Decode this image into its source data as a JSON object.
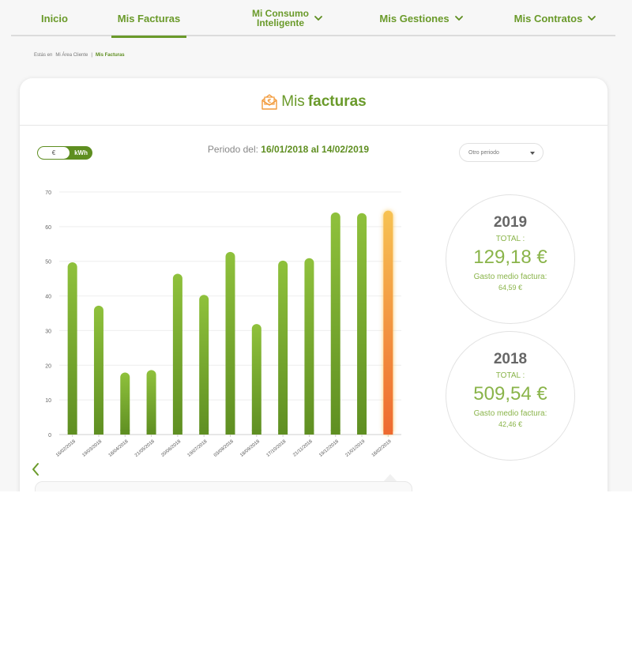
{
  "nav": {
    "items": [
      {
        "label": "Inicio",
        "dropdown": false,
        "active": false
      },
      {
        "label": "Mis Facturas",
        "dropdown": false,
        "active": true
      },
      {
        "label_line1": "Mi Consumo",
        "label_line2": "Inteligente",
        "dropdown": true,
        "active": false
      },
      {
        "label": "Mis Gestiones",
        "dropdown": true,
        "active": false
      },
      {
        "label": "Mis Contratos",
        "dropdown": true,
        "active": false
      }
    ]
  },
  "breadcrumb": {
    "prefix": "Estás en",
    "items": [
      "Mi Área Cliente",
      "|",
      "Mis Facturas"
    ]
  },
  "card": {
    "title_light": "Mis",
    "title_bold": "facturas",
    "title_icon": "invoice-euro-icon"
  },
  "unit_toggle": {
    "option_left": "€",
    "option_right": "kWh",
    "selected": "€"
  },
  "period": {
    "label": "Periodo del:",
    "dates": "16/01/2018 al 14/02/2019"
  },
  "period_select": {
    "value": "Otro periodo"
  },
  "chart_data": {
    "type": "bar",
    "categories": [
      "16/02/2018",
      "19/03/2018",
      "18/04/2018",
      "21/05/2018",
      "20/06/2018",
      "19/07/2018",
      "03/09/2018",
      "18/09/2018",
      "17/10/2018",
      "21/11/2018",
      "19/12/2018",
      "21/01/2019",
      "18/02/2019"
    ],
    "values": [
      49.7,
      37.2,
      17.9,
      18.6,
      46.4,
      40.3,
      52.7,
      31.9,
      50.2,
      50.9,
      64.1,
      63.9,
      64.6
    ],
    "highlighted_index": 12,
    "yticks": [
      0,
      10,
      20,
      30,
      40,
      50,
      60,
      70
    ],
    "ylim": [
      0,
      70
    ],
    "grid": true,
    "colors": {
      "bar": "#7aaa2a",
      "bar_highlight_top": "#f7c252",
      "bar_highlight_bottom": "#ee6a2f"
    }
  },
  "totals": [
    {
      "year": "2019",
      "label": "TOTAL :",
      "amount": "129,18 €",
      "avg_label": "Gasto medio factura:",
      "avg": "64,59 €"
    },
    {
      "year": "2018",
      "label": "TOTAL :",
      "amount": "509,54 €",
      "avg_label": "Gasto medio factura:",
      "avg": "42,46 €"
    }
  ],
  "colors": {
    "accent": "#6a9a2a",
    "accent_light": "#8ab44a",
    "highlight": "#f29a3a"
  }
}
